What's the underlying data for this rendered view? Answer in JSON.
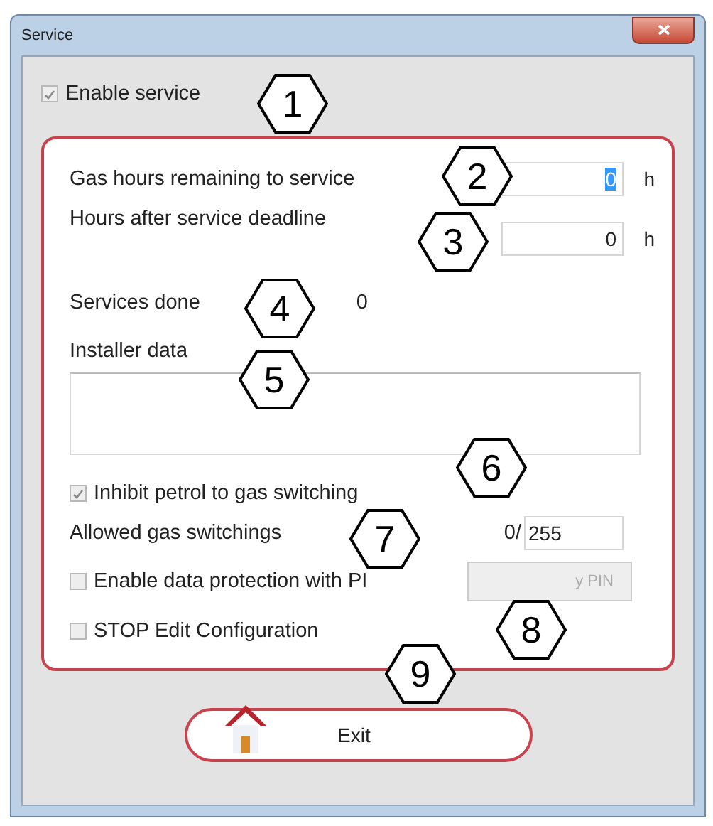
{
  "window": {
    "title": "Service"
  },
  "enable_service": {
    "label": "Enable service",
    "checked": true
  },
  "fields": [
    {
      "label": "Gas hours remaining to service",
      "value": "0",
      "unit": "h",
      "selected": true
    },
    {
      "label": "Hours after service deadline",
      "value": "0",
      "unit": "h",
      "selected": false
    }
  ],
  "services_done": {
    "label": "Services done",
    "value": "0"
  },
  "installer_data": {
    "label": "Installer data"
  },
  "inhibit_switching": {
    "label": "Inhibit petrol to gas switching",
    "checked": true
  },
  "allowed_switchings": {
    "label": "Allowed gas switchings",
    "count": "0/",
    "value": "255"
  },
  "data_protection": {
    "label": "Enable data protection with PI",
    "checked": false,
    "button": "y PIN"
  },
  "stop_edit": {
    "label": "STOP Edit Configuration",
    "checked": false
  },
  "exit_button": {
    "label": "Exit"
  },
  "callouts": [
    "1",
    "2",
    "3",
    "4",
    "5",
    "6",
    "7",
    "8",
    "9"
  ]
}
